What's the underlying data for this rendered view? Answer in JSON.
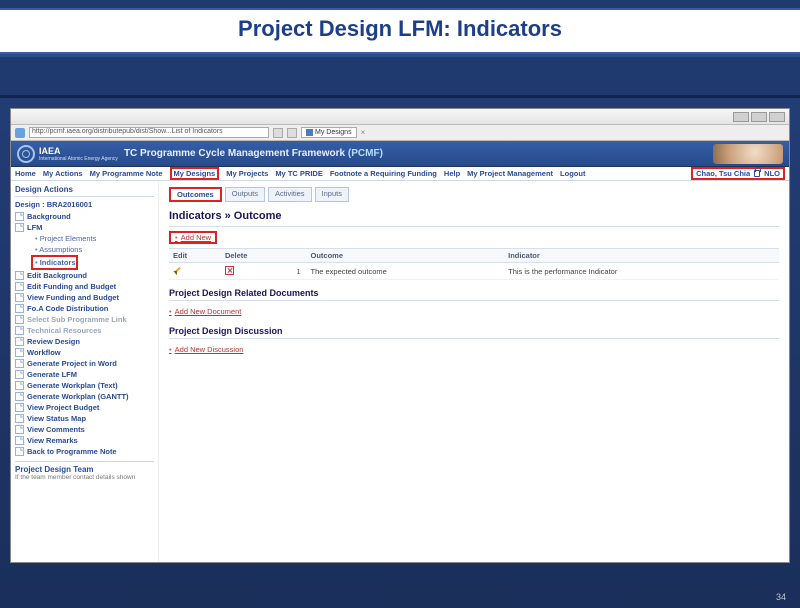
{
  "slide": {
    "title": "Project Design LFM: Indicators",
    "number": "34"
  },
  "browser": {
    "url": "http://pcmf.iaea.org/distributepub/dist/Show...List of Indicators",
    "tab_label": "My Designs",
    "tab_close": "×"
  },
  "app": {
    "org": "IAEA",
    "org_sub": "International Atomic Energy Agency",
    "product": "TC Programme Cycle Management Framework",
    "acronym": "(PCMF)"
  },
  "nav": {
    "items": [
      "Home",
      "My Actions",
      "My Programme Note",
      "My Designs",
      "My Projects",
      "My TC PRIDE",
      "Footnote a Requiring Funding",
      "Help",
      "My Project Management",
      "Logout"
    ],
    "highlight_index": 3,
    "highlight_index2": 9,
    "user_name": "Chao, Tsu Chia",
    "user_role": "NLO"
  },
  "sidebar": {
    "heading": "Design Actions",
    "design_label": "Design :",
    "design_id": "BRA2016001",
    "items": [
      {
        "label": "Background",
        "icon": "doc"
      },
      {
        "label": "LFM",
        "icon": "doc",
        "sub": [
          {
            "label": "Project Elements"
          },
          {
            "label": "Assumptions"
          },
          {
            "label": "Indicators",
            "hl": true
          }
        ]
      },
      {
        "label": "Edit Background",
        "icon": "doc"
      },
      {
        "label": "Edit Funding and Budget",
        "icon": "doc"
      },
      {
        "label": "View Funding and Budget",
        "icon": "doc"
      },
      {
        "label": "Fo.A Code Distribution",
        "icon": "doc"
      },
      {
        "label": "Select Sub Programme Link",
        "icon": "doc",
        "light": true
      },
      {
        "label": "Technical Resources",
        "icon": "doc",
        "light": true
      },
      {
        "label": "Review Design",
        "icon": "doc"
      },
      {
        "label": "Workflow",
        "icon": "doc"
      },
      {
        "label": "Generate Project in Word",
        "icon": "doc"
      },
      {
        "label": "Generate LFM",
        "icon": "doc"
      },
      {
        "label": "Generate Workplan (Text)",
        "icon": "doc"
      },
      {
        "label": "Generate Workplan (GANTT)",
        "icon": "doc"
      },
      {
        "label": "View Project Budget",
        "icon": "doc"
      },
      {
        "label": "View Status Map",
        "icon": "doc"
      },
      {
        "label": "View Comments",
        "icon": "doc"
      },
      {
        "label": "View Remarks",
        "icon": "doc"
      },
      {
        "label": "Back to Programme Note",
        "icon": "doc"
      }
    ],
    "team_heading": "Project Design Team",
    "team_text": "If the team member contact details shown"
  },
  "main": {
    "subtabs": [
      "Outcomes",
      "Outputs",
      "Activities",
      "Inputs"
    ],
    "active_subtab": 0,
    "heading": "Indicators » Outcome",
    "add_new": "Add New",
    "table": {
      "cols": [
        "Edit",
        "Delete",
        "",
        "Outcome",
        "Indicator"
      ],
      "rows": [
        {
          "num": "1",
          "outcome": "The expected outcome",
          "indicator": "This is the performance Indicator"
        }
      ]
    },
    "docs_heading": "Project Design Related Documents",
    "add_doc": "Add New Document",
    "disc_heading": "Project Design Discussion",
    "add_disc": "Add New Discussion"
  }
}
